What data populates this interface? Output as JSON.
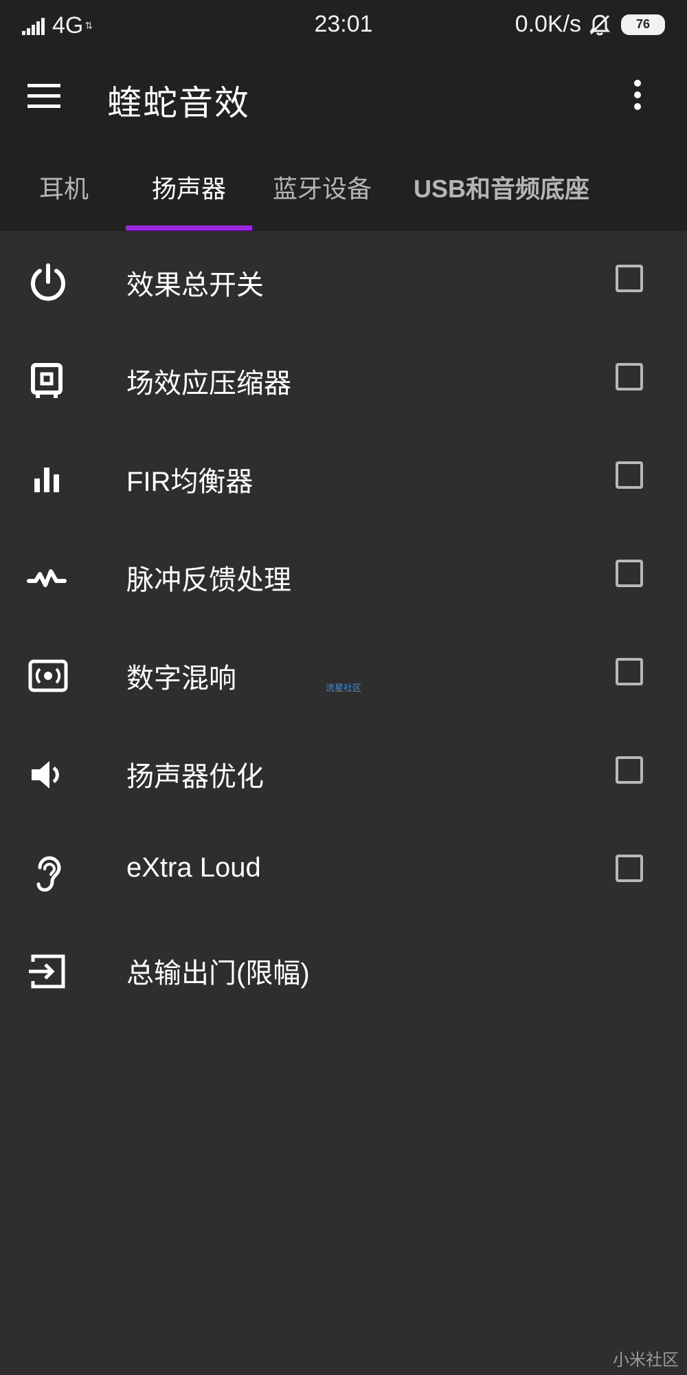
{
  "status_bar": {
    "network": "4G",
    "network_arrows": "⇅",
    "time": "23:01",
    "speed": "0.0K/s",
    "battery": "76"
  },
  "app_bar": {
    "title": "蝰蛇音效"
  },
  "tabs": [
    {
      "label": "耳机",
      "active": false
    },
    {
      "label": "扬声器",
      "active": true
    },
    {
      "label": "蓝牙设备",
      "active": false
    },
    {
      "label": "USB和音频底座",
      "active": false
    }
  ],
  "items": [
    {
      "label": "效果总开关",
      "icon": "power-icon",
      "checked": false
    },
    {
      "label": "场效应压缩器",
      "icon": "compressor-icon",
      "checked": false
    },
    {
      "label": "FIR均衡器",
      "icon": "equalizer-icon",
      "checked": false
    },
    {
      "label": "脉冲反馈处理",
      "icon": "pulse-icon",
      "checked": false
    },
    {
      "label": "数字混响",
      "icon": "reverb-icon",
      "checked": false
    },
    {
      "label": "扬声器优化",
      "icon": "speaker-icon",
      "checked": false
    },
    {
      "label": "eXtra Loud",
      "icon": "ear-icon",
      "checked": false
    },
    {
      "label": "总输出门(限幅)",
      "icon": "output-icon"
    }
  ],
  "watermarks": {
    "center": "流星社区",
    "bottom": "小米社区"
  },
  "colors": {
    "background": "#2e2e2e",
    "app_bar": "#212121",
    "accent": "#9c27e0",
    "checkbox_border": "#b8b8b8"
  }
}
